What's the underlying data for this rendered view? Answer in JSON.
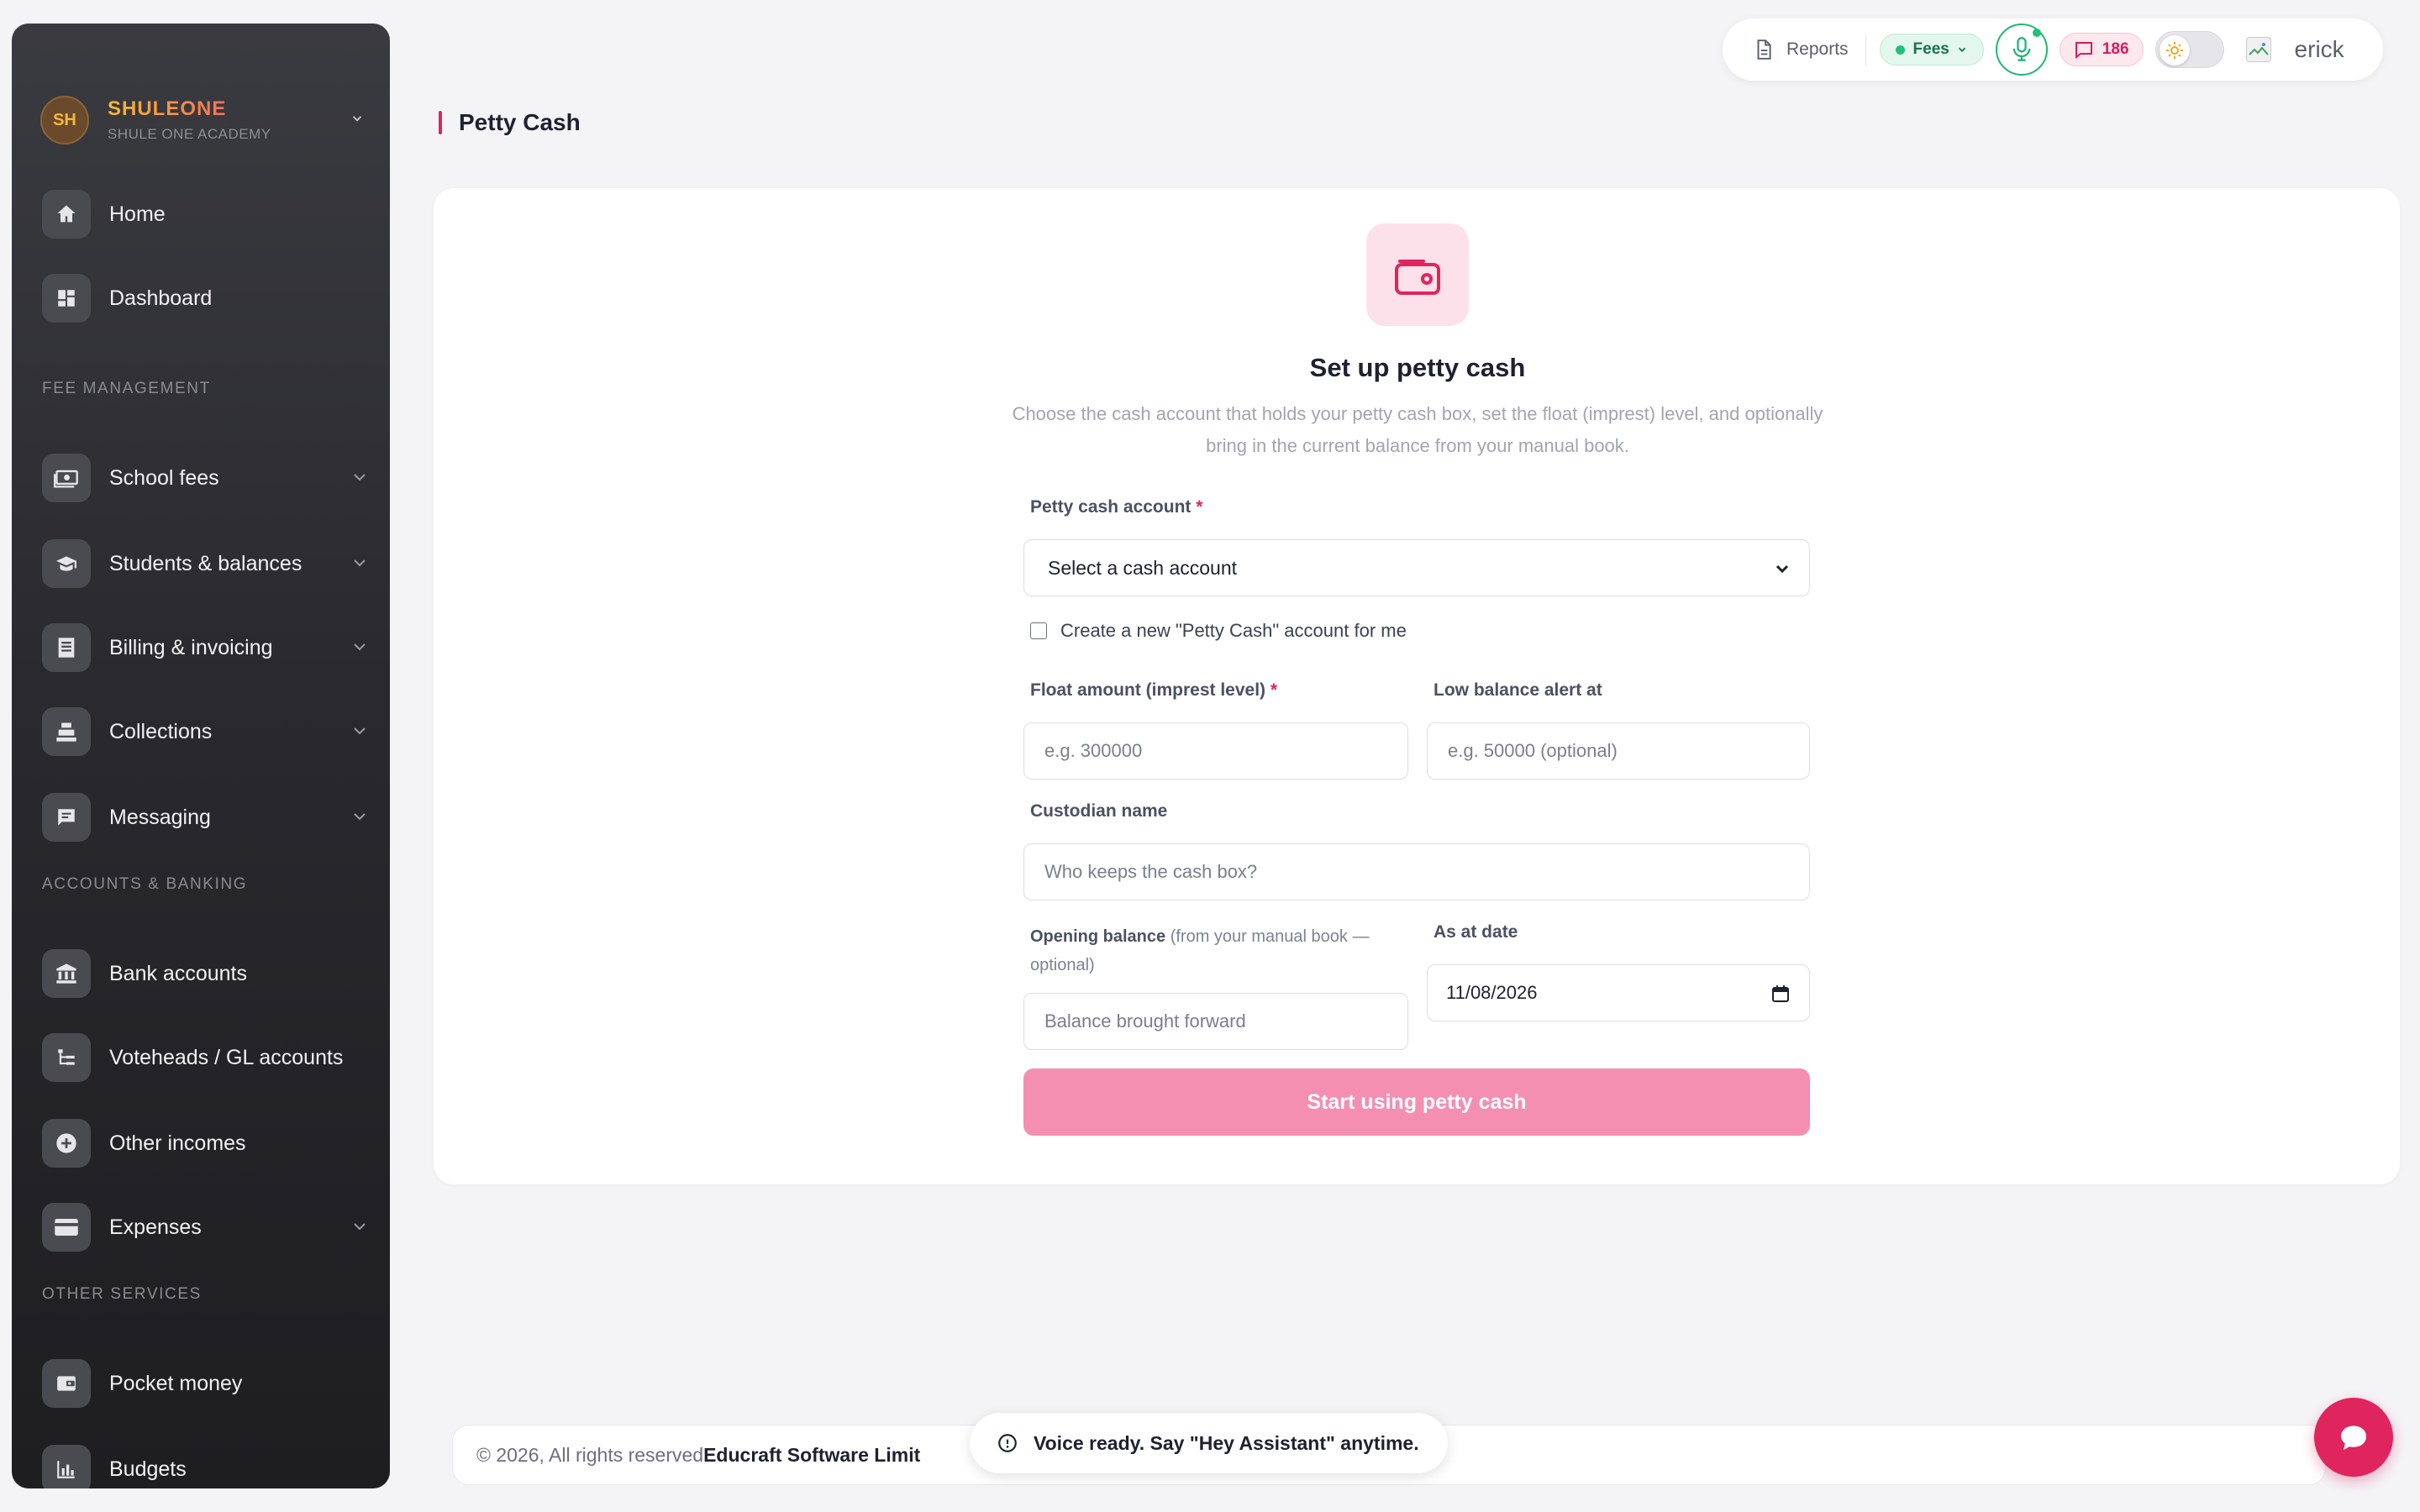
{
  "brand": {
    "initials": "SH",
    "name": "SHULEONE",
    "subtitle": "SHULE ONE ACADEMY"
  },
  "sidebar": {
    "items": [
      {
        "label": "Home",
        "icon": "home-icon"
      },
      {
        "label": "Dashboard",
        "icon": "dashboard-icon"
      },
      {
        "label": "School fees",
        "icon": "cash-icon"
      },
      {
        "label": "Students & balances",
        "icon": "graduation-cap-icon"
      },
      {
        "label": "Billing & invoicing",
        "icon": "invoice-icon"
      },
      {
        "label": "Collections",
        "icon": "cash-register-icon"
      },
      {
        "label": "Messaging",
        "icon": "message-icon"
      },
      {
        "label": "Bank accounts",
        "icon": "bank-icon"
      },
      {
        "label": "Voteheads / GL accounts",
        "icon": "tree-icon"
      },
      {
        "label": "Other incomes",
        "icon": "plus-circle-icon"
      },
      {
        "label": "Expenses",
        "icon": "card-icon"
      },
      {
        "label": "Pocket money",
        "icon": "wallet-icon"
      },
      {
        "label": "Budgets",
        "icon": "bar-chart-icon"
      }
    ],
    "sections": {
      "fee": "FEE MANAGEMENT",
      "accounts": "ACCOUNTS & BANKING",
      "other": "OTHER SERVICES"
    }
  },
  "topbar": {
    "reports": "Reports",
    "fees": "Fees",
    "messages_count": "186",
    "user": "erick"
  },
  "page": {
    "title": "Petty Cash"
  },
  "setup": {
    "title": "Set up petty cash",
    "description": "Choose the cash account that holds your petty cash box, set the float (imprest) level, and optionally bring in the current balance from your manual book.",
    "account_label": "Petty cash account",
    "account_required": "*",
    "account_select": "Select a cash account",
    "create_checkbox": "Create a new \"Petty Cash\" account for me",
    "float_label": "Float amount (imprest level)",
    "float_required": "*",
    "float_placeholder": "e.g. 300000",
    "alert_label": "Low balance alert at",
    "alert_placeholder": "e.g. 50000 (optional)",
    "custodian_label": "Custodian name",
    "custodian_placeholder": "Who keeps the cash box?",
    "opening_label": "Opening balance",
    "opening_hint": " (from your manual book — optional)",
    "opening_placeholder": "Balance brought forward",
    "date_label": "As at date",
    "date_value": "11/08/2026",
    "submit": "Start using petty cash"
  },
  "footer": {
    "text": "© 2026, All rights reserved ",
    "company": "Educraft Software Limit"
  },
  "toast": {
    "text": "Voice ready. Say \"Hey Assistant\" anytime."
  },
  "colors": {
    "accent": "#e0245e",
    "button": "#f48fb1",
    "success": "#22c07a"
  }
}
